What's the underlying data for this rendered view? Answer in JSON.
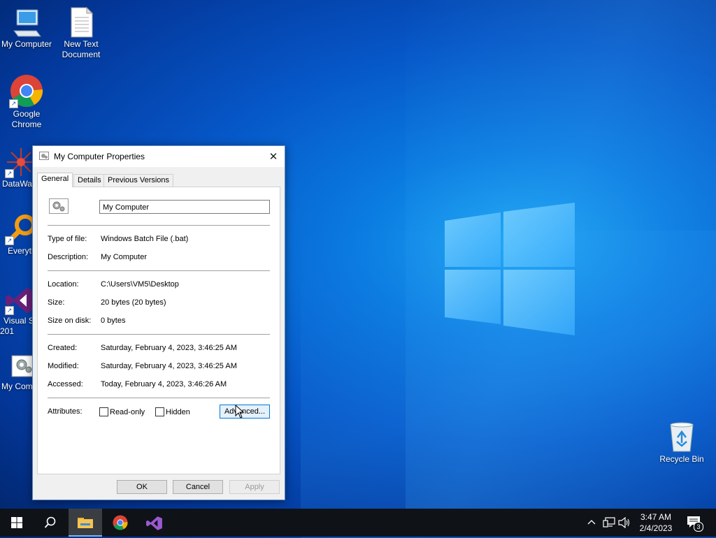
{
  "desktop": {
    "icons": [
      {
        "label": "My Computer"
      },
      {
        "label": "New Text Document"
      },
      {
        "label": "Google Chrome"
      },
      {
        "label": "DataWag"
      },
      {
        "label": "Everyth"
      },
      {
        "label": "Visual S 201"
      },
      {
        "label": "My Com"
      },
      {
        "label": "Recycle Bin"
      }
    ]
  },
  "dialog": {
    "title": "My Computer Properties",
    "tabs": [
      "General",
      "Details",
      "Previous Versions"
    ],
    "active_tab": "General",
    "name_value": "My Computer",
    "fields": {
      "type_label": "Type of file:",
      "type_value": "Windows Batch File (.bat)",
      "desc_label": "Description:",
      "desc_value": "My Computer",
      "location_label": "Location:",
      "location_value": "C:\\Users\\VM5\\Desktop",
      "size_label": "Size:",
      "size_value": "20 bytes (20 bytes)",
      "disk_label": "Size on disk:",
      "disk_value": "0 bytes",
      "created_label": "Created:",
      "created_value": "Saturday, February 4, 2023, 3:46:25 AM",
      "modified_label": "Modified:",
      "modified_value": "Saturday, February 4, 2023, 3:46:25 AM",
      "accessed_label": "Accessed:",
      "accessed_value": "Today, February 4, 2023, 3:46:26 AM"
    },
    "attributes": {
      "label": "Attributes:",
      "readonly_label": "Read-only",
      "hidden_label": "Hidden",
      "advanced_label": "Advanced..."
    },
    "buttons": {
      "ok": "OK",
      "cancel": "Cancel",
      "apply": "Apply"
    }
  },
  "taskbar": {
    "time": "3:47 AM",
    "date": "2/4/2023",
    "notification_count": "3"
  },
  "colors": {
    "accent": "#0078d7",
    "taskbar": "#0f1217"
  }
}
